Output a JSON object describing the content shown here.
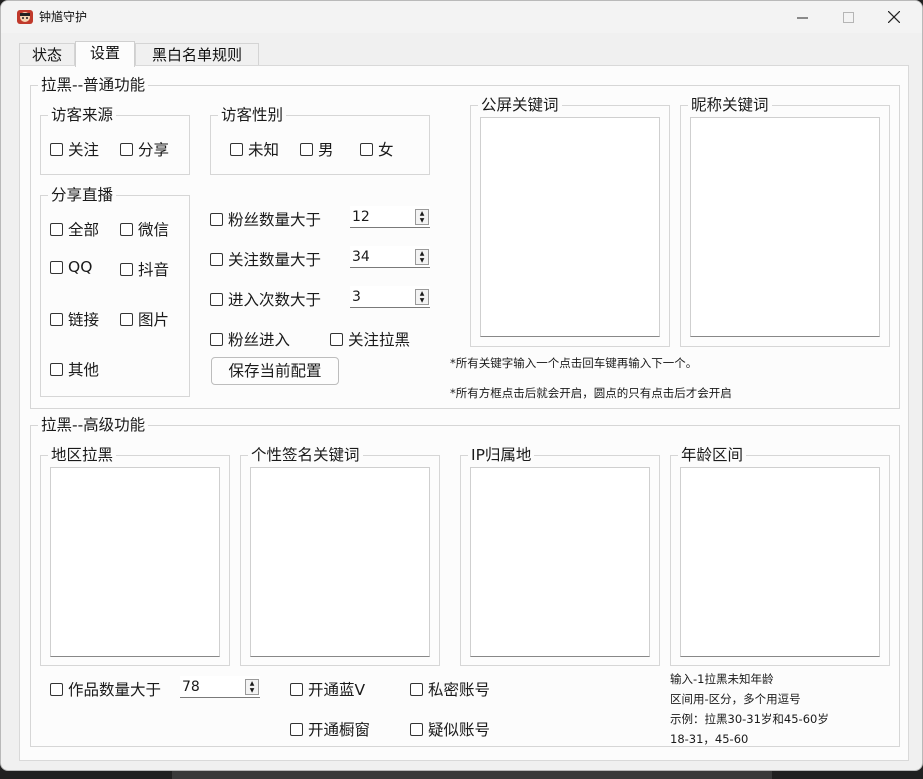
{
  "window": {
    "title": "钟馗守护"
  },
  "tabs": [
    {
      "label": "状态"
    },
    {
      "label": "设置"
    },
    {
      "label": "黑白名单规则"
    }
  ],
  "normal": {
    "section_title": "拉黑--普通功能",
    "visitor_source": {
      "label": "访客来源",
      "follow": "关注",
      "share": "分享"
    },
    "visitor_gender": {
      "label": "访客性别",
      "unknown": "未知",
      "male": "男",
      "female": "女"
    },
    "share_live": {
      "label": "分享直播",
      "all": "全部",
      "wechat": "微信",
      "qq": "QQ",
      "douyin": "抖音",
      "link": "链接",
      "image": "图片",
      "other": "其他"
    },
    "fans_gt": {
      "label": "粉丝数量大于",
      "value": "12"
    },
    "follow_gt": {
      "label": "关注数量大于",
      "value": "34"
    },
    "enter_gt": {
      "label": "进入次数大于",
      "value": "3"
    },
    "fans_enter": "粉丝进入",
    "follow_block": "关注拉黑",
    "save_button": "保存当前配置",
    "public_keywords": "公屏关键词",
    "nickname_keywords": "昵称关键词",
    "note1": "*所有关键字输入一个点击回车键再输入下一个。",
    "note2": "*所有方框点击后就会开启，圆点的只有点击后才会开启"
  },
  "advanced": {
    "section_title": "拉黑--高级功能",
    "region_block": "地区拉黑",
    "signature_keywords": "个性签名关键词",
    "ip_location": "IP归属地",
    "age_range": "年龄区间",
    "works_gt": {
      "label": "作品数量大于",
      "value": "78"
    },
    "blue_v": "开通蓝V",
    "showcase": "开通橱窗",
    "private_account": "私密账号",
    "suspect_account": "疑似账号",
    "age_notes": [
      "输入-1拉黑未知年龄",
      "区间用-区分，多个用逗号",
      "示例：拉黑30-31岁和45-60岁",
      "18-31，45-60"
    ]
  }
}
